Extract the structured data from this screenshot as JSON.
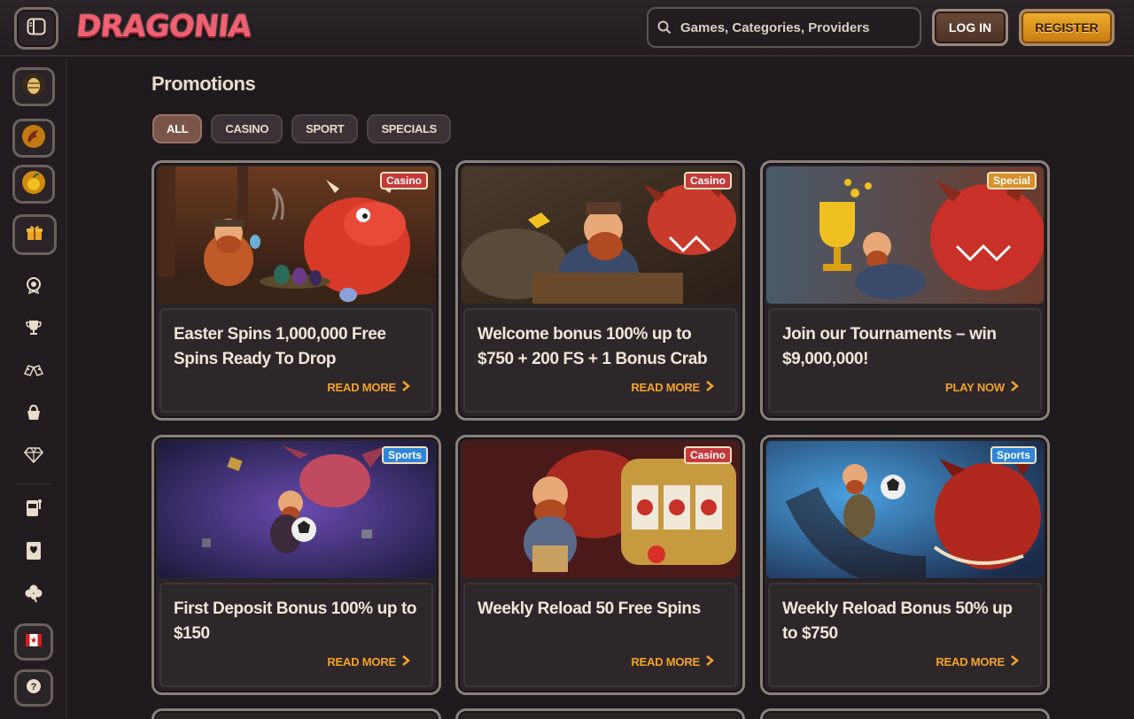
{
  "header": {
    "logo": "DRAGONIA",
    "search_placeholder": "Games, Categories, Providers",
    "login_label": "LOG IN",
    "register_label": "REGISTER"
  },
  "sidebar": {
    "items": [
      {
        "icon": "egg-icon"
      },
      {
        "icon": "dragon-claw-icon"
      },
      {
        "icon": "fruit-icon"
      },
      {
        "icon": "gift-icon"
      },
      {
        "icon": "badge-icon"
      },
      {
        "icon": "trophy-icon"
      },
      {
        "icon": "racing-flags-icon"
      },
      {
        "icon": "basket-icon"
      },
      {
        "icon": "diamond-icon"
      },
      {
        "icon": "slot-machine-icon"
      },
      {
        "icon": "playing-card-icon"
      },
      {
        "icon": "clover-icon"
      },
      {
        "icon": "canada-flag-icon"
      },
      {
        "icon": "help-icon"
      }
    ]
  },
  "main": {
    "title": "Promotions",
    "filters": [
      "ALL",
      "CASINO",
      "SPORT",
      "SPECIALS"
    ],
    "active_filter": "ALL",
    "cards": [
      {
        "badge": "Casino",
        "title": "Easter Spins 1,000,000 Free Spins Ready To Drop",
        "cta": "READ MORE"
      },
      {
        "badge": "Casino",
        "title": "Welcome bonus 100% up to $750 + 200 FS + 1 Bonus Crab",
        "cta": "READ MORE"
      },
      {
        "badge": "Special",
        "title": "Join our Tournaments – win $9,000,000!",
        "cta": "PLAY NOW"
      },
      {
        "badge": "Sports",
        "title": "First Deposit Bonus 100% up to $150",
        "cta": "READ MORE"
      },
      {
        "badge": "Casino",
        "title": "Weekly Reload 50 Free Spins",
        "cta": "READ MORE"
      },
      {
        "badge": "Sports",
        "title": "Weekly Reload Bonus 50% up to $750",
        "cta": "READ MORE"
      }
    ]
  },
  "colors": {
    "accent": "#f3a32a",
    "casino_badge": "#c33a3a",
    "sports_badge": "#2f86d8",
    "special_badge": "#d7912b"
  }
}
